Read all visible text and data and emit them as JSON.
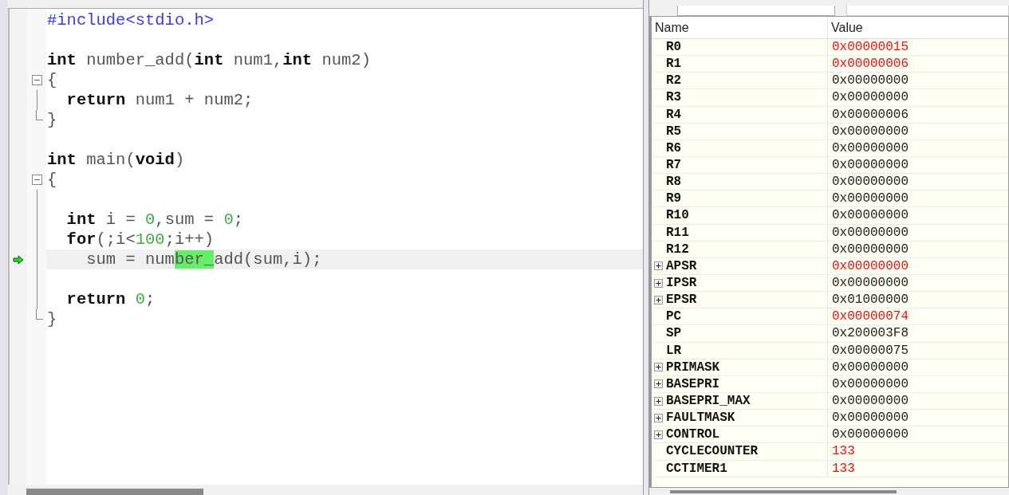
{
  "editor": {
    "lines": [
      {
        "foldable": false,
        "block_end": false,
        "current": false,
        "tokens": [
          {
            "kind": "pp",
            "text": "#include<stdio.h>"
          }
        ]
      },
      {
        "foldable": false,
        "block_end": false,
        "current": false
      },
      {
        "foldable": false,
        "block_end": false,
        "current": false,
        "tokens": [
          {
            "kind": "kw",
            "text": "int"
          },
          {
            "kind": "id",
            "text": " number_add("
          },
          {
            "kind": "kw",
            "text": "int"
          },
          {
            "kind": "id",
            "text": " num1,"
          },
          {
            "kind": "kw",
            "text": "int"
          },
          {
            "kind": "id",
            "text": " num2)"
          }
        ]
      },
      {
        "foldable": true,
        "block_end": false,
        "current": false,
        "tokens": [
          {
            "kind": "id",
            "text": "{"
          }
        ]
      },
      {
        "foldable": false,
        "block_end": false,
        "current": false,
        "tokens": [
          {
            "kind": "kw",
            "text": "  return"
          },
          {
            "kind": "id",
            "text": " num1 + num2;"
          }
        ]
      },
      {
        "foldable": false,
        "block_end": true,
        "current": false,
        "tokens": [
          {
            "kind": "id",
            "text": "}"
          }
        ]
      },
      {
        "foldable": false,
        "block_end": false,
        "current": false
      },
      {
        "foldable": false,
        "block_end": false,
        "current": false,
        "tokens": [
          {
            "kind": "kw",
            "text": "int"
          },
          {
            "kind": "id",
            "text": " main("
          },
          {
            "kind": "kw",
            "text": "void"
          },
          {
            "kind": "id",
            "text": ")"
          }
        ]
      },
      {
        "foldable": true,
        "block_end": false,
        "current": false,
        "tokens": [
          {
            "kind": "id",
            "text": "{"
          }
        ]
      },
      {
        "foldable": false,
        "block_end": false,
        "current": false
      },
      {
        "foldable": false,
        "block_end": false,
        "current": false,
        "tokens": [
          {
            "kind": "kw",
            "text": "  int"
          },
          {
            "kind": "id",
            "text": " i = "
          },
          {
            "kind": "num",
            "text": "0"
          },
          {
            "kind": "id",
            "text": ",sum = "
          },
          {
            "kind": "num",
            "text": "0"
          },
          {
            "kind": "id",
            "text": ";"
          }
        ]
      },
      {
        "foldable": false,
        "block_end": false,
        "current": false,
        "tokens": [
          {
            "kind": "kw",
            "text": "  for"
          },
          {
            "kind": "id",
            "text": "(;i<"
          },
          {
            "kind": "num",
            "text": "100"
          },
          {
            "kind": "id",
            "text": ";i++)"
          }
        ]
      },
      {
        "foldable": false,
        "block_end": false,
        "current": true,
        "tokens": [
          {
            "kind": "id",
            "text": "    sum = num"
          },
          {
            "kind": "match",
            "text": "ber_"
          },
          {
            "kind": "id",
            "text": "add(sum,i);"
          }
        ]
      },
      {
        "foldable": false,
        "block_end": false,
        "current": false
      },
      {
        "foldable": false,
        "block_end": false,
        "current": false,
        "tokens": [
          {
            "kind": "kw",
            "text": "  return"
          },
          {
            "kind": "num",
            "text": " 0"
          },
          {
            "kind": "id",
            "text": ";"
          }
        ]
      },
      {
        "foldable": false,
        "block_end": true,
        "current": false,
        "tokens": [
          {
            "kind": "id",
            "text": "}"
          }
        ]
      }
    ]
  },
  "registers": {
    "columns": [
      "Name",
      "Value"
    ],
    "rows": [
      {
        "name": "R0",
        "value": "0x00000015",
        "changed": true,
        "expandable": false
      },
      {
        "name": "R1",
        "value": "0x00000006",
        "changed": true,
        "expandable": false
      },
      {
        "name": "R2",
        "value": "0x00000000",
        "changed": false,
        "expandable": false
      },
      {
        "name": "R3",
        "value": "0x00000000",
        "changed": false,
        "expandable": false
      },
      {
        "name": "R4",
        "value": "0x00000006",
        "changed": false,
        "expandable": false
      },
      {
        "name": "R5",
        "value": "0x00000000",
        "changed": false,
        "expandable": false
      },
      {
        "name": "R6",
        "value": "0x00000000",
        "changed": false,
        "expandable": false
      },
      {
        "name": "R7",
        "value": "0x00000000",
        "changed": false,
        "expandable": false
      },
      {
        "name": "R8",
        "value": "0x00000000",
        "changed": false,
        "expandable": false
      },
      {
        "name": "R9",
        "value": "0x00000000",
        "changed": false,
        "expandable": false
      },
      {
        "name": "R10",
        "value": "0x00000000",
        "changed": false,
        "expandable": false
      },
      {
        "name": "R11",
        "value": "0x00000000",
        "changed": false,
        "expandable": false
      },
      {
        "name": "R12",
        "value": "0x00000000",
        "changed": false,
        "expandable": false
      },
      {
        "name": "APSR",
        "value": "0x00000000",
        "changed": true,
        "expandable": true
      },
      {
        "name": "IPSR",
        "value": "0x00000000",
        "changed": false,
        "expandable": true
      },
      {
        "name": "EPSR",
        "value": "0x01000000",
        "changed": false,
        "expandable": true
      },
      {
        "name": "PC",
        "value": "0x00000074",
        "changed": true,
        "expandable": false
      },
      {
        "name": "SP",
        "value": "0x200003F8",
        "changed": false,
        "expandable": false
      },
      {
        "name": "LR",
        "value": "0x00000075",
        "changed": false,
        "expandable": false
      },
      {
        "name": "PRIMASK",
        "value": "0x00000000",
        "changed": false,
        "expandable": true
      },
      {
        "name": "BASEPRI",
        "value": "0x00000000",
        "changed": false,
        "expandable": true
      },
      {
        "name": "BASEPRI_MAX",
        "value": "0x00000000",
        "changed": false,
        "expandable": true
      },
      {
        "name": "FAULTMASK",
        "value": "0x00000000",
        "changed": false,
        "expandable": true
      },
      {
        "name": "CONTROL",
        "value": "0x00000000",
        "changed": false,
        "expandable": true
      },
      {
        "name": "CYCLECOUNTER",
        "value": "133",
        "changed": true,
        "expandable": false
      },
      {
        "name": "CCTIMER1",
        "value": "133",
        "changed": true,
        "expandable": false
      }
    ]
  }
}
